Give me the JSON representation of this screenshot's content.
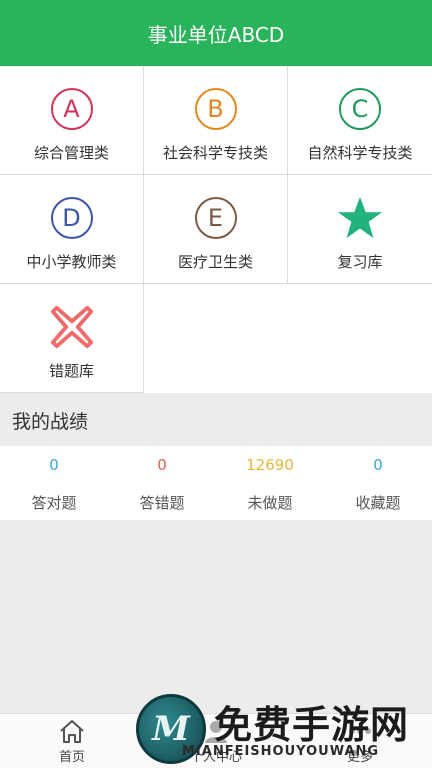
{
  "header": {
    "title": "事业单位ABCD"
  },
  "grid": [
    {
      "letter": "A",
      "color": "#d0345a",
      "label": "综合管理类"
    },
    {
      "letter": "B",
      "color": "#e08a1e",
      "label": "社会科学专技类"
    },
    {
      "letter": "C",
      "color": "#1f9a5a",
      "label": "自然科学专技类"
    },
    {
      "letter": "D",
      "color": "#3d56a6",
      "label": "中小学教师类"
    },
    {
      "letter": "E",
      "color": "#7a5a46",
      "label": "医疗卫生类"
    },
    {
      "icon": "star-icon",
      "color": "#22b27c",
      "label": "复习库"
    },
    {
      "icon": "cross-icon",
      "color": "#ef6b6b",
      "label": "错题库"
    }
  ],
  "performance": {
    "title": "我的战绩",
    "stats": [
      {
        "value": "0",
        "color": "#3ba3d9",
        "label": "答对题"
      },
      {
        "value": "0",
        "color": "#e0604f",
        "label": "答错题"
      },
      {
        "value": "12690",
        "color": "#e6b43a",
        "label": "未做题"
      },
      {
        "value": "0",
        "color": "#3ba3d9",
        "label": "收藏题"
      }
    ]
  },
  "tabbar": [
    {
      "icon": "home-icon",
      "label": "首页"
    },
    {
      "icon": "person-icon",
      "label": "个人中心"
    },
    {
      "icon": "more-icon",
      "label": "更多"
    }
  ],
  "watermark": {
    "main": "免费手游网",
    "sub": "MIANFEISHOUYOUWANG"
  }
}
